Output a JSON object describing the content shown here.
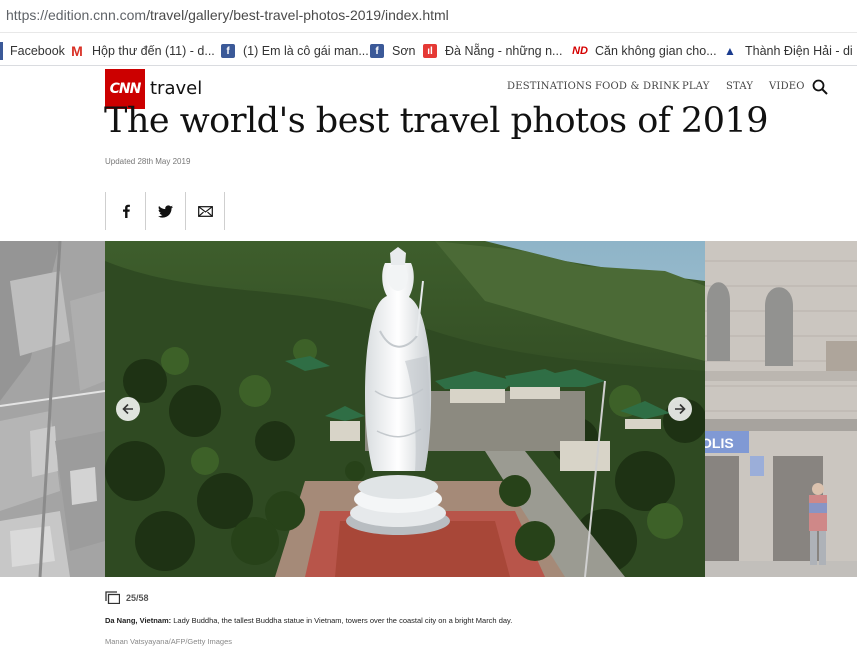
{
  "browser": {
    "url_prefix": "https://edition.cnn.com",
    "url_path": "/travel/gallery/best-travel-photos-2019/index.html"
  },
  "bookmarks": [
    {
      "label": "Facebook",
      "icon": "facebook-icon"
    },
    {
      "label": "Hộp thư đến (11) - d...",
      "icon": "gmail-icon"
    },
    {
      "label": "(1) Em là cô gái man...",
      "icon": "facebook-icon"
    },
    {
      "label": "Sơn",
      "icon": "facebook-icon"
    },
    {
      "label": "Đà Nẵng - những n...",
      "icon": "danang-icon"
    },
    {
      "label": "Căn không gian cho...",
      "icon": "nd-icon"
    },
    {
      "label": "Thành Điện Hải - di ...",
      "icon": "monument-icon"
    }
  ],
  "header": {
    "logo_text": "CNN",
    "section": "travel",
    "nav": [
      "DESTINATIONS",
      "FOOD & DRINK",
      "PLAY",
      "STAY",
      "VIDEO"
    ]
  },
  "article": {
    "title": "The world's best travel photos of 2019",
    "updated": "Updated 28th May 2019"
  },
  "gallery": {
    "counter": "25/58",
    "caption_location": "Da Nang, Vietnam:",
    "caption_text": " Lady Buddha, the tallest Buddha statue in Vietnam, towers over the coastal city on a bright March day.",
    "credit": "Manan Vatsyayana/AFP/Getty Images",
    "next_slide_sign": "OLIS"
  },
  "colors": {
    "cnn_red": "#cc0000",
    "facebook_blue": "#3b5998"
  }
}
